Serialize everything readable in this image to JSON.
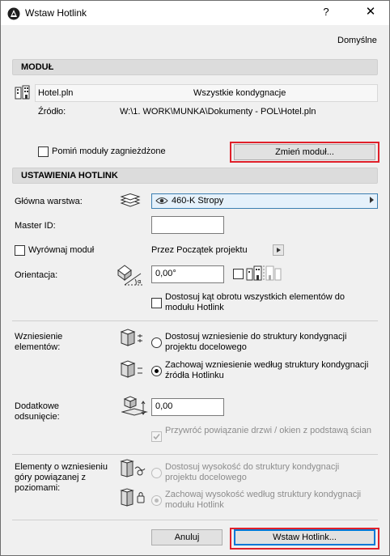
{
  "window": {
    "title": "Wstaw Hotlink",
    "help": "?",
    "close": "✕"
  },
  "defaults_label": "Domyślne",
  "module": {
    "header": "MODUŁ",
    "file_name": "Hotel.pln",
    "stories": "Wszystkie kondygnacje",
    "source_label": "Źródło:",
    "source_path": "W:\\1. WORK\\MUNKA\\Dokumenty - POL\\Hotel.pln",
    "skip_nested_label": "Pomiń moduły zagnieżdżone",
    "change_module_button": "Zmień moduł..."
  },
  "settings": {
    "header": "USTAWIENIA HOTLINK",
    "main_layer_label": "Główna warstwa:",
    "main_layer_value": "460-K Stropy",
    "master_id_label": "Master ID:",
    "master_id_value": "",
    "align_module_label": "Wyrównaj moduł",
    "align_value": "Przez Początek projektu",
    "orientation_label": "Orientacja:",
    "orientation_value": "0,00°",
    "adjust_rotation_label": "Dostosuj kąt obrotu wszystkich elementów do modułu Hotlink"
  },
  "elevation": {
    "label": "Wzniesienie elementów:",
    "option1": "Dostosuj wzniesienie do struktury kondygnacji projektu docelowego",
    "option2": "Zachowaj wzniesienie według struktury kondygnacji źródła Hotlinku"
  },
  "offset": {
    "label": "Dodatkowe odsunięcie:",
    "value": "0,00",
    "restore_label": "Przywróć powiązanie drzwi / okien z podstawą ścian"
  },
  "top_linked": {
    "label": "Elementy o wzniesieniu góry powiązanej z poziomami:",
    "option1": "Dostosuj wysokość do struktury kondygnacji projektu docelowego",
    "option2": "Zachowaj wysokość według struktury kondygnacji modułu Hotlink"
  },
  "footer": {
    "cancel": "Anuluj",
    "place": "Wstaw Hotlink..."
  },
  "colors": {
    "highlight": "#e0202a",
    "accent": "#1a5fb4"
  }
}
